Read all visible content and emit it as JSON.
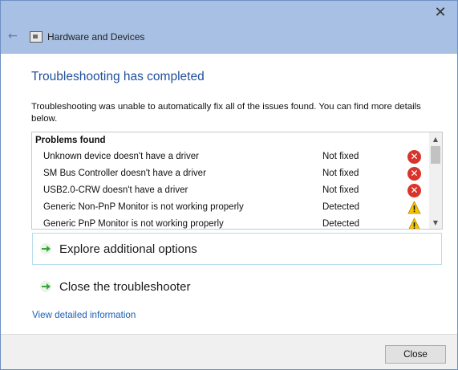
{
  "window": {
    "title": "Hardware and Devices",
    "close_icon": "close-icon",
    "back_icon": "back-arrow-icon"
  },
  "main": {
    "heading": "Troubleshooting has completed",
    "description": "Troubleshooting was unable to automatically fix all of the issues found. You can find more details below."
  },
  "problems": {
    "header": "Problems found",
    "items": [
      {
        "name": "Unknown device doesn't have a driver",
        "status": "Not fixed",
        "icon": "error-icon"
      },
      {
        "name": "SM Bus Controller doesn't have a driver",
        "status": "Not fixed",
        "icon": "error-icon"
      },
      {
        "name": "USB2.0-CRW doesn't have a driver",
        "status": "Not fixed",
        "icon": "error-icon"
      },
      {
        "name": "Generic Non-PnP Monitor is not working properly",
        "status": "Detected",
        "icon": "warning-icon"
      },
      {
        "name": "Generic PnP Monitor is not working properly",
        "status": "Detected",
        "icon": "warning-icon"
      }
    ]
  },
  "options": {
    "explore": "Explore additional options",
    "close": "Close the troubleshooter"
  },
  "links": {
    "details": "View detailed information"
  },
  "footer": {
    "close_label": "Close"
  },
  "colors": {
    "titlebar": "#a8c0e4",
    "heading": "#1f4e9a",
    "link": "#1a5fb4",
    "error": "#d9342b",
    "warning": "#f5c400",
    "arrow": "#3aa53a"
  }
}
